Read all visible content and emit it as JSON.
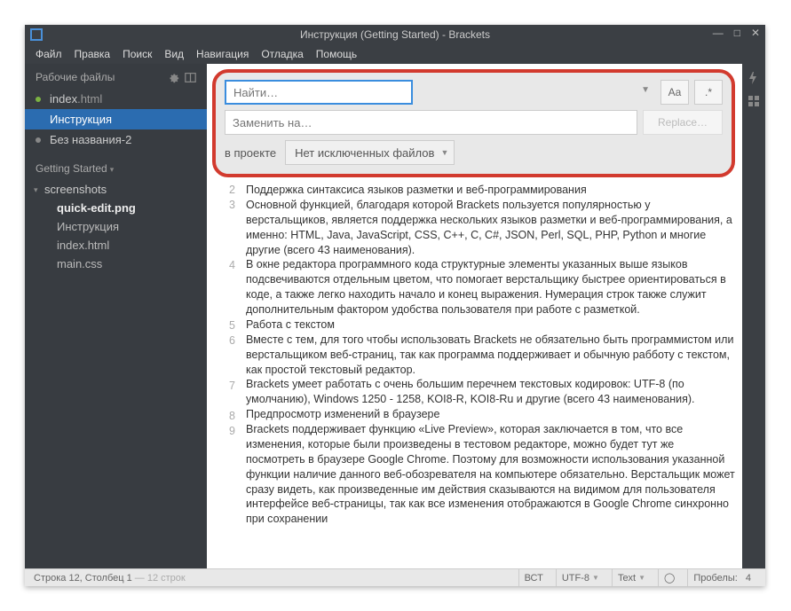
{
  "title": "Инструкция (Getting Started) - Brackets",
  "menu": [
    "Файл",
    "Правка",
    "Поиск",
    "Вид",
    "Навигация",
    "Отладка",
    "Помощь"
  ],
  "sidebar": {
    "working_title": "Рабочие файлы",
    "working": [
      {
        "name": "index",
        "ext": ".html",
        "dot": "green",
        "sel": false
      },
      {
        "name": "Инструкция",
        "ext": "",
        "dot": "",
        "sel": true
      },
      {
        "name": "Без названия-2",
        "ext": "",
        "dot": "grey",
        "sel": false
      }
    ],
    "project": "Getting Started",
    "folder": "screenshots",
    "files": [
      {
        "name": "quick-edit.png",
        "bold": true
      },
      {
        "name": "Инструкция",
        "bold": false
      },
      {
        "name": "index.html",
        "bold": false
      },
      {
        "name": "main.css",
        "bold": false
      }
    ]
  },
  "search": {
    "find_placeholder": "Найти…",
    "replace_placeholder": "Заменить на…",
    "replace_btn": "Replace…",
    "case": "Aa",
    "regex": ".*",
    "scope": "в проекте",
    "exclude": "Нет исключенных файлов"
  },
  "code": [
    {
      "n": "2",
      "t": "Поддержка синтаксиса языков разметки и веб-программирования"
    },
    {
      "n": "3",
      "t": "Основной функцией, благодаря которой Brackets пользуется популярностью у верстальщиков, является поддержка нескольких языков разметки и веб-программирования, а именно: HTML, Java, JavaScript, CSS, C++, C, C#, JSON, Perl, SQL, PHP, Python и многие другие (всего 43 наименования)."
    },
    {
      "n": "4",
      "t": "В окне редактора программного кода структурные элементы указанных выше языков подсвечиваются отдельным цветом, что помогает верстальщику быстрее ориентироваться в коде, а также легко находить начало и конец выражения. Нумерация строк также служит дополнительным фактором удобства пользователя при работе с разметкой."
    },
    {
      "n": "5",
      "t": "Работа с текстом"
    },
    {
      "n": "6",
      "t": "Вместе с тем, для того чтобы использовать Brackets не обязательно быть программистом или верстальщиком веб-страниц, так как программа поддерживает и обычную рабботу с текстом, как простой текстовый редактор."
    },
    {
      "n": "7",
      "t": "Brackets умеет работать с очень большим перечнем текстовых кодировок: UTF-8 (по умолчанию), Windows 1250 - 1258, KOI8-R, KOI8-Ru и другие (всего 43 наименования)."
    },
    {
      "n": "8",
      "t": "Предпросмотр изменений в браузере"
    },
    {
      "n": "9",
      "t": "Brackets поддерживает функцию «Live Preview», которая заключается в том, что все изменения, которые были произведены в тестовом редакторе, можно будет тут же посмотреть в браузере Google Chrome. Поэтому для возможности использования указанной функции наличие данного веб-обозревателя на компьютере обязательно. Верстальщик может сразу видеть, как произведенные им действия сказываются на видимом для пользователя интерфейсе веб-страницы, так как все изменения отображаются в Google Chrome синхронно при сохранении"
    }
  ],
  "status": {
    "pos": "Строка 12, Столбец 1",
    "sel": " — 12 строк",
    "ins": "ВСТ",
    "enc": "UTF-8",
    "lang": "Text",
    "spaces_lbl": "Пробелы:",
    "spaces_n": "4"
  }
}
